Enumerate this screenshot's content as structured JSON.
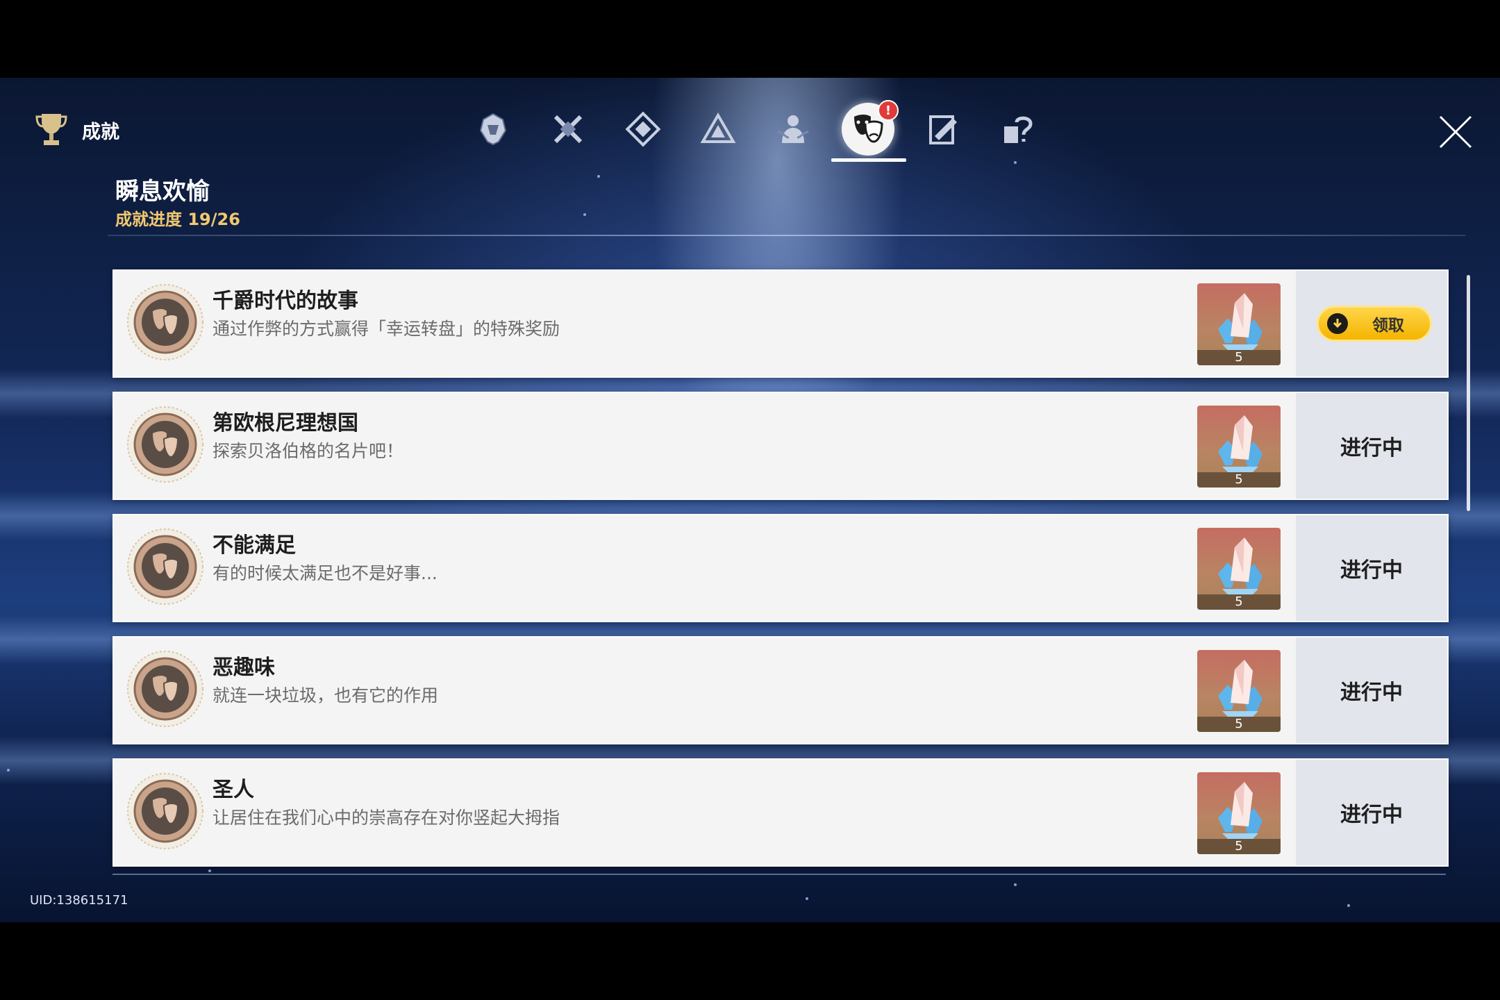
{
  "header": {
    "title": "成就",
    "close_icon": "close-icon",
    "trophy_icon": "trophy-icon"
  },
  "tabs": [
    {
      "icon": "helmet-emblem-icon",
      "active": false
    },
    {
      "icon": "crossed-swords-icon",
      "active": false
    },
    {
      "icon": "diamond-crest-icon",
      "active": false
    },
    {
      "icon": "triangle-emblem-icon",
      "active": false
    },
    {
      "icon": "figure-emblem-icon",
      "active": false
    },
    {
      "icon": "masks-icon",
      "active": true,
      "badge": "!"
    },
    {
      "icon": "notebook-icon",
      "active": false
    },
    {
      "icon": "question-puzzle-icon",
      "active": false
    }
  ],
  "category": {
    "title": "瞬息欢愉",
    "progress": "成就进度 19/26"
  },
  "achievements": [
    {
      "title": "千爵时代的故事",
      "description": "通过作弊的方式赢得「幸运转盘」的特殊奖励",
      "reward_count": "5",
      "status": "领取",
      "claimable": true
    },
    {
      "title": "第欧根尼理想国",
      "description": "探索贝洛伯格的名片吧！",
      "reward_count": "5",
      "status": "进行中",
      "claimable": false
    },
    {
      "title": "不能满足",
      "description": "有的时候太满足也不是好事...",
      "reward_count": "5",
      "status": "进行中",
      "claimable": false
    },
    {
      "title": "恶趣味",
      "description": "就连一块垃圾，也有它的作用",
      "reward_count": "5",
      "status": "进行中",
      "claimable": false
    },
    {
      "title": "圣人",
      "description": "让居住在我们心中的崇高存在对你竖起大拇指",
      "reward_count": "5",
      "status": "进行中",
      "claimable": false
    }
  ],
  "footer": {
    "uid": "UID:138615171"
  },
  "colors": {
    "accent_gold": "#f2c870",
    "claim_button": "#f4b400",
    "badge_red": "#e23a3a"
  }
}
